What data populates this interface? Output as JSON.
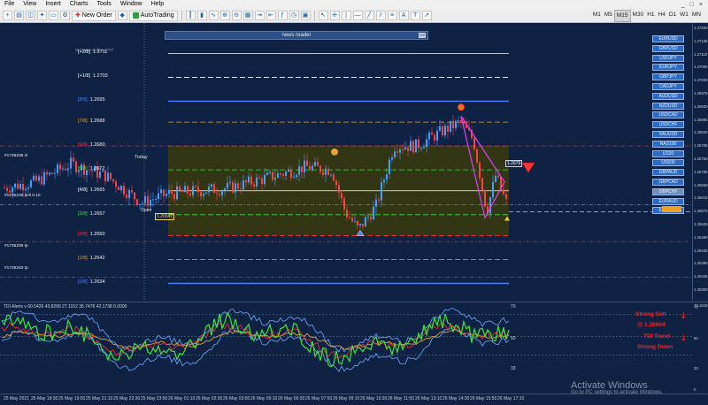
{
  "menu": {
    "items": [
      "File",
      "View",
      "Insert",
      "Charts",
      "Tools",
      "Window",
      "Help"
    ],
    "window_controls": [
      "_",
      "□",
      "×"
    ]
  },
  "toolbar": {
    "new_order_label": "New Order",
    "autotrading_label": "AutoTrading",
    "timeframes": [
      "M1",
      "M5",
      "M15",
      "M30",
      "H1",
      "H4",
      "D1",
      "W1",
      "MN"
    ],
    "active_timeframe": "M15"
  },
  "news_panel": {
    "title": "news reader",
    "close_label": "C8"
  },
  "chart": {
    "header_note": "M Frame Sell) 1.2707",
    "today_label": "Today",
    "open_label": "Open",
    "open_price_tag": "1.26547",
    "current_price_tag": "1.2679",
    "colors": {
      "bull": "#3ea0ff",
      "bear": "#ff4040",
      "zone": "#3a3a0d",
      "accent": "#e040fb"
    },
    "murrey_levels": [
      {
        "label": "[+2/8]",
        "value": "1.2711",
        "color": "#ffffff"
      },
      {
        "label": "[+1/8]",
        "value": "1.2703",
        "color": "#ffffff"
      },
      {
        "label": "[8/8]",
        "value": "1.2695",
        "color": "#4d7dff"
      },
      {
        "label": "[7/8]",
        "value": "1.2688",
        "color": "#e8a030"
      },
      {
        "label": "[6/8]",
        "value": "1.2680",
        "color": "#ff3030"
      },
      {
        "label": "[5/8]",
        "value": "1.2672",
        "color": "#38e038"
      },
      {
        "label": "[4/8]",
        "value": "1.2665",
        "color": "#ffffff"
      },
      {
        "label": "[3/8]",
        "value": "1.2657",
        "color": "#38e038"
      },
      {
        "label": "[2/8]",
        "value": "1.2650",
        "color": "#ff3030"
      },
      {
        "label": "[1/8]",
        "value": "1.2642",
        "color": "#e8a030"
      },
      {
        "label": "[0/8]",
        "value": "1.2634",
        "color": "#4d7dff"
      },
      {
        "label": "[-1/8]",
        "value": "1.2627",
        "color": "#ffffff"
      }
    ],
    "order_labels": [
      "#1735238 sl",
      "#1735239 sell 0.10",
      "#1735239 tp",
      "#1735240 tp"
    ],
    "price_axis": [
      "1.27200",
      "1.27155",
      "1.27110",
      "1.27065",
      "1.27020",
      "1.26975",
      "1.26930",
      "1.26885",
      "1.26840",
      "1.26795",
      "1.26750",
      "1.26705",
      "1.26660",
      "1.26615",
      "1.26570",
      "1.26525",
      "1.26480",
      "1.26435",
      "1.26390",
      "1.26345",
      "1.26300"
    ]
  },
  "symbols": [
    "EURUSD",
    "GBPUSD",
    "USDJPY",
    "EURJPY",
    "GBPJPY",
    "CADJPY",
    "AUDUSD",
    "NZDUSD",
    "USDCAD",
    "USDCHF",
    "XAUUSD",
    "NAS100",
    "US30",
    "US500",
    "GBPAUD",
    "GBPCAD",
    "GBPCHF",
    "EURAUD",
    "EURGBP"
  ],
  "active_symbol": "GBPCHF",
  "indicator": {
    "title": "TDI Alerts v 60.5426 43.8289 27.1152 35.7478 42.1738 0.0000",
    "axis_right": [
      "78.1619",
      "70",
      "50",
      "33",
      "0"
    ],
    "axis_left_markers": [
      "70",
      "50",
      "33"
    ],
    "signal_line1": "Strong Sell",
    "signal_line2": "@ 1.26604",
    "signal_line3": "TDI Trend",
    "signal_line4": "Strong Down"
  },
  "time_axis": [
    "25 May 2021",
    "25 May 18:30",
    "25 May 19:50",
    "25 May 21:10",
    "25 May 22:30",
    "25 May 23:50",
    "26 May 01:10",
    "26 May 02:30",
    "26 May 03:50",
    "26 May 05:10",
    "26 May 06:30",
    "26 May 07:50",
    "26 May 09:10",
    "26 May 10:30",
    "26 May 11:50",
    "26 May 13:10",
    "26 May 14:30",
    "26 May 15:50",
    "26 May 17:10"
  ],
  "os_overlay": {
    "title": "Activate Windows",
    "subtitle": "Go to PC settings to activate Windows."
  }
}
